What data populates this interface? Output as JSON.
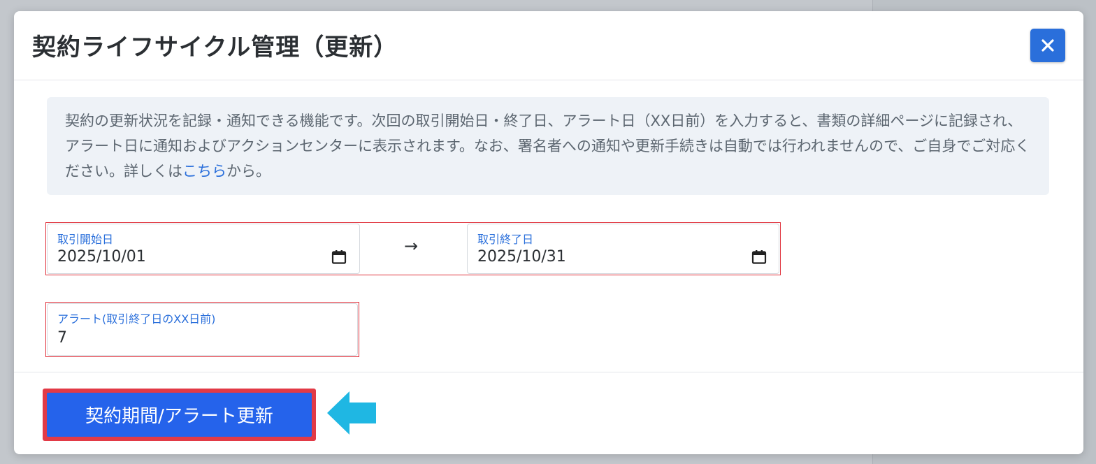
{
  "modal": {
    "title": "契約ライフサイクル管理（更新）",
    "close_label": "×",
    "info": {
      "text_before_link": "契約の更新状況を記録・通知できる機能です。次回の取引開始日・終了日、アラート日（XX日前）を入力すると、書類の詳細ページに記録され、アラート日に通知およびアクションセンターに表示されます。なお、署名者への通知や更新手続きは自動では行われませんので、ご自身でご対応ください。詳しくは",
      "link_text": "こちら",
      "text_after_link": "から。"
    },
    "start_date": {
      "label": "取引開始日",
      "value": "2025/10/01",
      "icon": "calendar-icon"
    },
    "range_arrow": "→",
    "end_date": {
      "label": "取引終了日",
      "value": "2025/10/31",
      "icon": "calendar-icon"
    },
    "alert": {
      "label": "アラート(取引終了日のXX日前)",
      "value": "7"
    },
    "submit_label": "契約期間/アラート更新"
  },
  "colors": {
    "primary": "#2563eb",
    "highlight_red": "#e23a46",
    "pointer_cyan": "#1fb7e3"
  }
}
